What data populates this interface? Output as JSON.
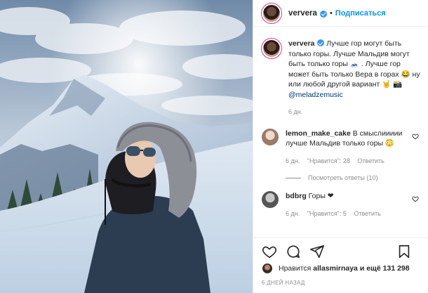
{
  "header": {
    "username": "ververa",
    "separator": "•",
    "follow_label": "Подписаться"
  },
  "caption": {
    "username": "ververa",
    "text": "Лучше гор могут быть только горы. Лучше Мальдив могут быть только горы 🗻 . Лучше гор может быть только Вера в горах 😂 ну или любой другой вариант 🤘 📸",
    "mention": "@meladzemusic",
    "age": "6 дн."
  },
  "comments": [
    {
      "username": "lemon_make_cake",
      "text": "В смыслиииии лучше Мальдив только горы 😳",
      "age": "6 дн.",
      "likes": "\"Нравится\": 28",
      "reply": "Ответить",
      "view_replies": "Посмотреть ответы (10)"
    },
    {
      "username": "bdbrg",
      "text": "Горы ❤",
      "age": "6 дн.",
      "likes": "\"Нравится\": 5",
      "reply": "Ответить"
    }
  ],
  "likes": {
    "prefix": "Нравится",
    "user": "allasmirnaya",
    "suffix": "и ещё 131 298"
  },
  "timestamp": "6 ДНЕЙ НАЗАД",
  "icons": [
    "heart-icon",
    "comment-icon",
    "share-icon",
    "bookmark-icon",
    "verified-icon"
  ],
  "colors": {
    "accent": "#0095f6",
    "verified": "#3897f0",
    "text": "#262626",
    "muted": "#8e8e8e"
  }
}
